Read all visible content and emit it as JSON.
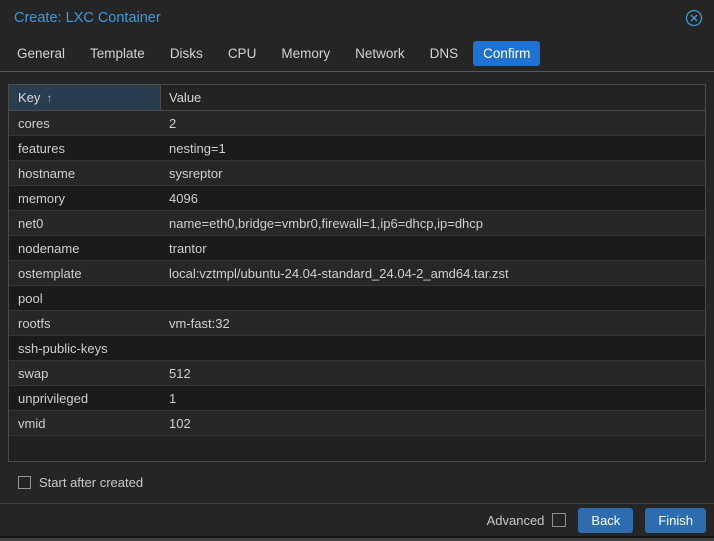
{
  "dialog": {
    "title": "Create: LXC Container",
    "close_icon": "circle-x-icon"
  },
  "tabs": [
    {
      "label": "General",
      "active": false
    },
    {
      "label": "Template",
      "active": false
    },
    {
      "label": "Disks",
      "active": false
    },
    {
      "label": "CPU",
      "active": false
    },
    {
      "label": "Memory",
      "active": false
    },
    {
      "label": "Network",
      "active": false
    },
    {
      "label": "DNS",
      "active": false
    },
    {
      "label": "Confirm",
      "active": true
    }
  ],
  "table": {
    "columns": {
      "key": "Key",
      "value": "Value"
    },
    "sort": {
      "column": "Key",
      "direction": "asc",
      "arrow": "↑"
    },
    "rows": [
      {
        "key": "cores",
        "value": "2"
      },
      {
        "key": "features",
        "value": "nesting=1"
      },
      {
        "key": "hostname",
        "value": "sysreptor"
      },
      {
        "key": "memory",
        "value": "4096"
      },
      {
        "key": "net0",
        "value": "name=eth0,bridge=vmbr0,firewall=1,ip6=dhcp,ip=dhcp"
      },
      {
        "key": "nodename",
        "value": "trantor"
      },
      {
        "key": "ostemplate",
        "value": "local:vztmpl/ubuntu-24.04-standard_24.04-2_amd64.tar.zst"
      },
      {
        "key": "pool",
        "value": ""
      },
      {
        "key": "rootfs",
        "value": "vm-fast:32"
      },
      {
        "key": "ssh-public-keys",
        "value": ""
      },
      {
        "key": "swap",
        "value": "512"
      },
      {
        "key": "unprivileged",
        "value": "1"
      },
      {
        "key": "vmid",
        "value": "102"
      }
    ]
  },
  "footer": {
    "start_after_created_label": "Start after created",
    "start_after_created_checked": false,
    "advanced_label": "Advanced",
    "advanced_checked": false,
    "back_label": "Back",
    "finish_label": "Finish"
  },
  "colors": {
    "title_blue": "#3d9ad8",
    "active_tab_blue": "#1f72d1",
    "button_blue": "#2e6cb0",
    "key_header_bg": "#2a3c50",
    "row_odd_bg": "#272727",
    "row_even_bg": "#1b1b1b",
    "dialog_bg": "#252525"
  }
}
